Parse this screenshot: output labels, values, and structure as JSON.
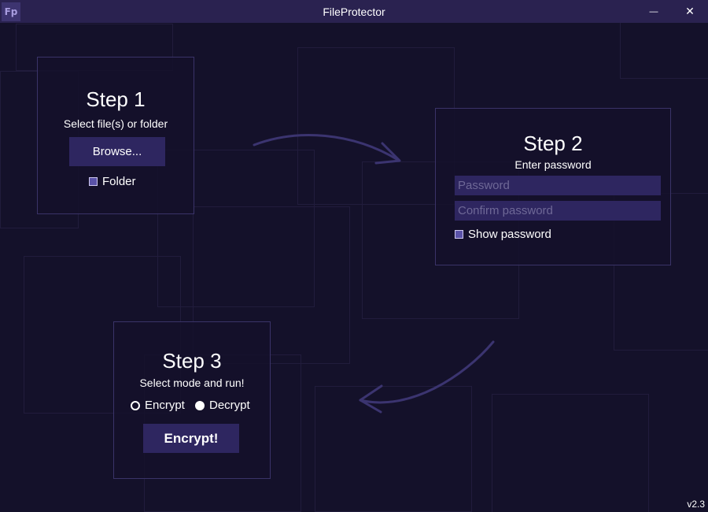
{
  "window": {
    "logo_text": "Fp",
    "title": "FileProtector",
    "minimize_symbol": "—",
    "close_symbol": "✕"
  },
  "step1": {
    "title": "Step 1",
    "subtitle": "Select file(s) or folder",
    "browse_label": "Browse...",
    "folder_label": "Folder",
    "folder_checked": false
  },
  "step2": {
    "title": "Step 2",
    "subtitle": "Enter password",
    "password_placeholder": "Password",
    "password_value": "",
    "confirm_placeholder": "Confirm password",
    "confirm_value": "",
    "show_password_label": "Show password",
    "show_password_checked": false
  },
  "step3": {
    "title": "Step 3",
    "subtitle": "Select mode and run!",
    "mode_options": [
      "Encrypt",
      "Decrypt"
    ],
    "selected_mode": "Encrypt",
    "encrypt_label": "Encrypt",
    "decrypt_label": "Decrypt",
    "run_label": "Encrypt!"
  },
  "footer": {
    "version": "v2.3"
  },
  "colors": {
    "background": "#14112a",
    "titlebar": "#2a2250",
    "panel_border": "#3a3368",
    "control": "#2e2660",
    "arrow": "#3b3470"
  },
  "icons": {
    "logo": "fp-logo-icon",
    "minimize": "minimize-icon",
    "close": "close-icon",
    "arrow_1_to_2": "curved-arrow-right-icon",
    "arrow_2_to_3": "curved-arrow-left-icon"
  }
}
